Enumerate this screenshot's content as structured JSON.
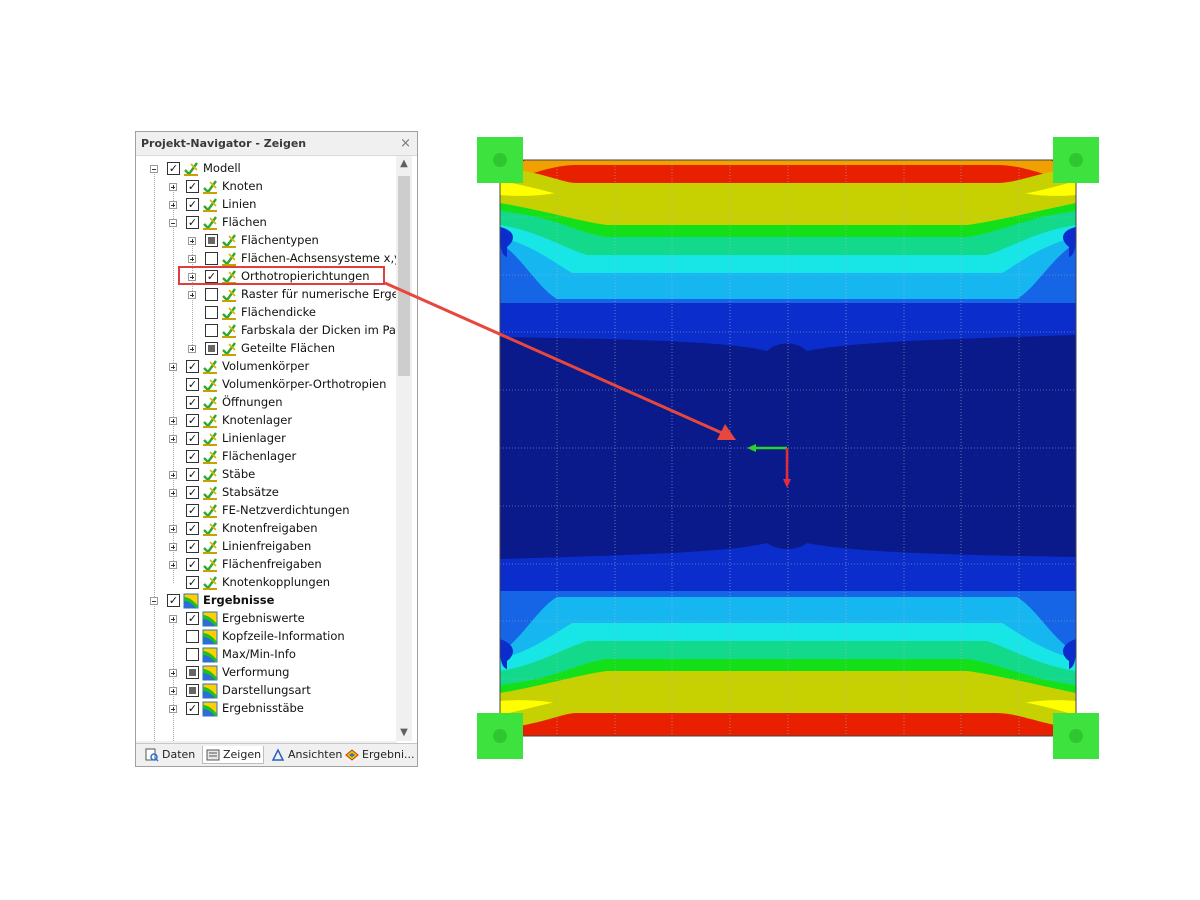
{
  "navigator": {
    "title": "Projekt-Navigator - Zeigen",
    "close_glyph": "×",
    "items": [
      {
        "label": "Modell",
        "level": 0,
        "expander": "minus",
        "check": "checked",
        "icon": "model-icon"
      },
      {
        "label": "Knoten",
        "level": 1,
        "expander": "plus",
        "check": "checked",
        "icon": "model-icon"
      },
      {
        "label": "Linien",
        "level": 1,
        "expander": "plus",
        "check": "checked",
        "icon": "model-icon"
      },
      {
        "label": "Flächen",
        "level": 1,
        "expander": "minus",
        "check": "checked",
        "icon": "model-icon"
      },
      {
        "label": "Flächentypen",
        "level": 2,
        "expander": "plus",
        "check": "partial",
        "icon": "model-icon"
      },
      {
        "label": "Flächen-Achsensysteme x,y,z",
        "level": 2,
        "expander": "plus",
        "check": "unchecked",
        "icon": "model-icon"
      },
      {
        "label": "Orthotropierichtungen",
        "level": 2,
        "expander": "plus",
        "check": "checked",
        "icon": "model-icon",
        "highlighted": true
      },
      {
        "label": "Raster für numerische Ergebnisse",
        "level": 2,
        "expander": "plus",
        "check": "unchecked",
        "icon": "model-icon"
      },
      {
        "label": "Flächendicke",
        "level": 2,
        "expander": "none",
        "check": "unchecked",
        "icon": "model-icon"
      },
      {
        "label": "Farbskala der Dicken im Panel",
        "level": 2,
        "expander": "none",
        "check": "unchecked",
        "icon": "model-icon"
      },
      {
        "label": "Geteilte Flächen",
        "level": 2,
        "expander": "plus",
        "check": "partial",
        "icon": "model-icon"
      },
      {
        "label": "Volumenkörper",
        "level": 1,
        "expander": "plus",
        "check": "checked",
        "icon": "model-icon"
      },
      {
        "label": "Volumenkörper-Orthotropien",
        "level": 1,
        "expander": "none",
        "check": "checked",
        "icon": "model-icon"
      },
      {
        "label": "Öffnungen",
        "level": 1,
        "expander": "none",
        "check": "checked",
        "icon": "model-icon"
      },
      {
        "label": "Knotenlager",
        "level": 1,
        "expander": "plus",
        "check": "checked",
        "icon": "model-icon"
      },
      {
        "label": "Linienlager",
        "level": 1,
        "expander": "plus",
        "check": "checked",
        "icon": "model-icon"
      },
      {
        "label": "Flächenlager",
        "level": 1,
        "expander": "none",
        "check": "checked",
        "icon": "model-icon"
      },
      {
        "label": "Stäbe",
        "level": 1,
        "expander": "plus",
        "check": "checked",
        "icon": "model-icon"
      },
      {
        "label": "Stabsätze",
        "level": 1,
        "expander": "plus",
        "check": "checked",
        "icon": "model-icon"
      },
      {
        "label": "FE-Netzverdichtungen",
        "level": 1,
        "expander": "none",
        "check": "checked",
        "icon": "model-icon"
      },
      {
        "label": "Knotenfreigaben",
        "level": 1,
        "expander": "plus",
        "check": "checked",
        "icon": "model-icon"
      },
      {
        "label": "Linienfreigaben",
        "level": 1,
        "expander": "plus",
        "check": "checked",
        "icon": "model-icon"
      },
      {
        "label": "Flächenfreigaben",
        "level": 1,
        "expander": "plus",
        "check": "checked",
        "icon": "model-icon"
      },
      {
        "label": "Knotenkopplungen",
        "level": 1,
        "expander": "none",
        "check": "checked",
        "icon": "model-icon"
      },
      {
        "label": "Ergebnisse",
        "level": 0,
        "expander": "minus",
        "check": "checked",
        "icon": "results-icon",
        "bold": true
      },
      {
        "label": "Ergebniswerte",
        "level": 1,
        "expander": "plus",
        "check": "checked",
        "icon": "results-icon"
      },
      {
        "label": "Kopfzeile-Information",
        "level": 1,
        "expander": "none",
        "check": "unchecked",
        "icon": "results-icon"
      },
      {
        "label": "Max/Min-Info",
        "level": 1,
        "expander": "none",
        "check": "unchecked",
        "icon": "results-icon"
      },
      {
        "label": "Verformung",
        "level": 1,
        "expander": "plus",
        "check": "partial",
        "icon": "results-icon"
      },
      {
        "label": "Darstellungsart",
        "level": 1,
        "expander": "plus",
        "check": "partial",
        "icon": "results-icon"
      },
      {
        "label": "Ergebnisstäbe",
        "level": 1,
        "expander": "plus",
        "check": "checked",
        "icon": "results-icon"
      }
    ],
    "tabs": [
      {
        "label": "Daten",
        "icon": "data-icon",
        "active": false
      },
      {
        "label": "Zeigen",
        "icon": "display-icon",
        "active": true
      },
      {
        "label": "Ansichten",
        "icon": "views-icon",
        "active": false
      },
      {
        "label": "Ergebni...",
        "icon": "results-icon",
        "active": false
      }
    ]
  },
  "colors": {
    "highlight": "#e03d3d",
    "arrow": "#e8473d",
    "support": "#3ee23e",
    "contour": [
      "#0a1a8a",
      "#0b2dcc",
      "#1565e6",
      "#16b7f0",
      "#18e6e6",
      "#13d98a",
      "#14e01a",
      "#c7d000",
      "#ffff00",
      "#f0a000",
      "#e82000"
    ]
  }
}
